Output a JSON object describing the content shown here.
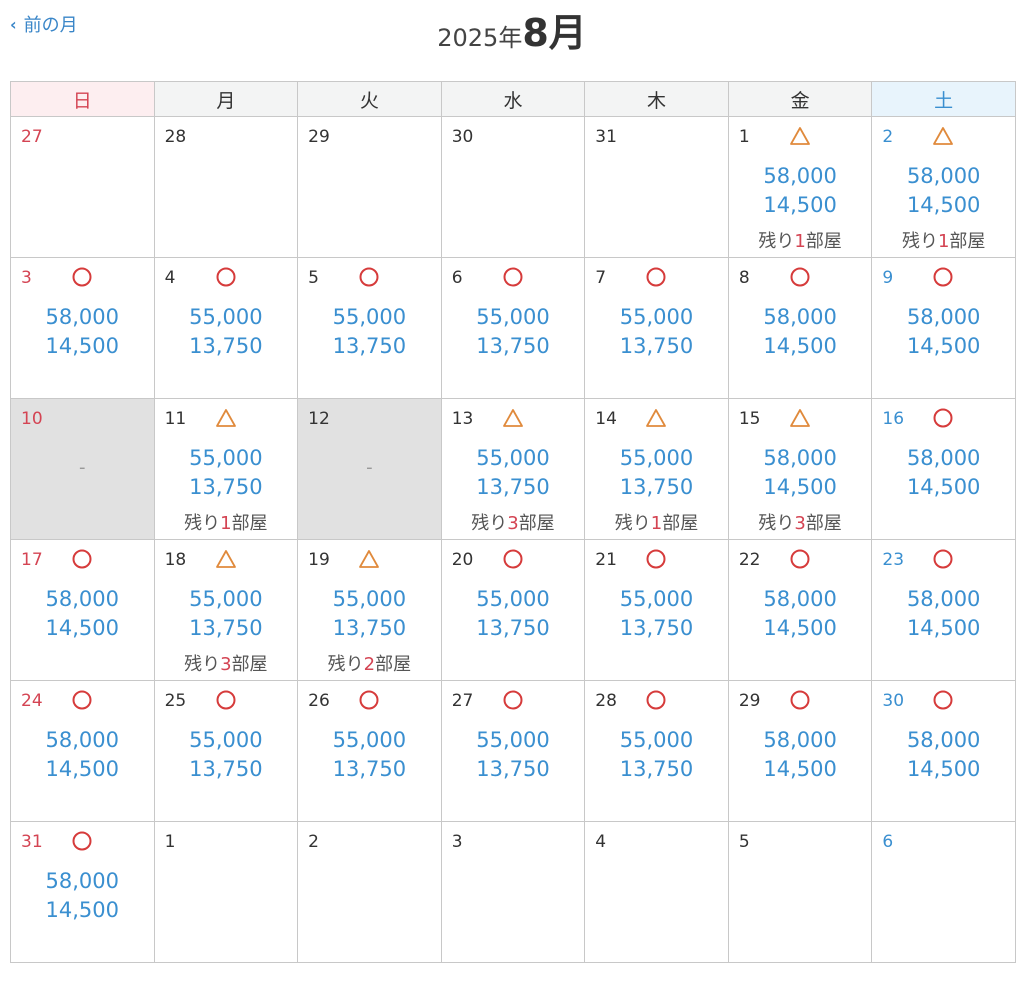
{
  "header": {
    "prev_label": "前の月",
    "year_label": "2025年",
    "month_label": "8月"
  },
  "weekdays": [
    "日",
    "月",
    "火",
    "水",
    "木",
    "金",
    "土"
  ],
  "legend_marks": {
    "circle": "○",
    "triangle": "△"
  },
  "colors": {
    "accent_blue": "#3a8fd0",
    "sunday_red": "#d44453",
    "circle_red": "#d63b3b",
    "triangle_orange": "#e08a3c",
    "closed_gray": "#e1e1e1"
  },
  "remaining_text": {
    "prefix": "残り",
    "suffix": "部屋"
  },
  "weeks": [
    [
      {
        "day": "27"
      },
      {
        "day": "28"
      },
      {
        "day": "29"
      },
      {
        "day": "30"
      },
      {
        "day": "31"
      },
      {
        "day": "1",
        "mark": "triangle",
        "price1": "58,000",
        "price2": "14,500",
        "remaining": "1"
      },
      {
        "day": "2",
        "mark": "triangle",
        "price1": "58,000",
        "price2": "14,500",
        "remaining": "1"
      }
    ],
    [
      {
        "day": "3",
        "mark": "circle",
        "price1": "58,000",
        "price2": "14,500"
      },
      {
        "day": "4",
        "mark": "circle",
        "price1": "55,000",
        "price2": "13,750"
      },
      {
        "day": "5",
        "mark": "circle",
        "price1": "55,000",
        "price2": "13,750"
      },
      {
        "day": "6",
        "mark": "circle",
        "price1": "55,000",
        "price2": "13,750"
      },
      {
        "day": "7",
        "mark": "circle",
        "price1": "55,000",
        "price2": "13,750"
      },
      {
        "day": "8",
        "mark": "circle",
        "price1": "58,000",
        "price2": "14,500"
      },
      {
        "day": "9",
        "mark": "circle",
        "price1": "58,000",
        "price2": "14,500"
      }
    ],
    [
      {
        "day": "10",
        "closed": true,
        "dash": "-"
      },
      {
        "day": "11",
        "mark": "triangle",
        "price1": "55,000",
        "price2": "13,750",
        "remaining": "1"
      },
      {
        "day": "12",
        "closed": true,
        "dash": "-"
      },
      {
        "day": "13",
        "mark": "triangle",
        "price1": "55,000",
        "price2": "13,750",
        "remaining": "3"
      },
      {
        "day": "14",
        "mark": "triangle",
        "price1": "55,000",
        "price2": "13,750",
        "remaining": "1"
      },
      {
        "day": "15",
        "mark": "triangle",
        "price1": "58,000",
        "price2": "14,500",
        "remaining": "3"
      },
      {
        "day": "16",
        "mark": "circle",
        "price1": "58,000",
        "price2": "14,500"
      }
    ],
    [
      {
        "day": "17",
        "mark": "circle",
        "price1": "58,000",
        "price2": "14,500"
      },
      {
        "day": "18",
        "mark": "triangle",
        "price1": "55,000",
        "price2": "13,750",
        "remaining": "3"
      },
      {
        "day": "19",
        "mark": "triangle",
        "price1": "55,000",
        "price2": "13,750",
        "remaining": "2"
      },
      {
        "day": "20",
        "mark": "circle",
        "price1": "55,000",
        "price2": "13,750"
      },
      {
        "day": "21",
        "mark": "circle",
        "price1": "55,000",
        "price2": "13,750"
      },
      {
        "day": "22",
        "mark": "circle",
        "price1": "58,000",
        "price2": "14,500"
      },
      {
        "day": "23",
        "mark": "circle",
        "price1": "58,000",
        "price2": "14,500"
      }
    ],
    [
      {
        "day": "24",
        "mark": "circle",
        "price1": "58,000",
        "price2": "14,500"
      },
      {
        "day": "25",
        "mark": "circle",
        "price1": "55,000",
        "price2": "13,750"
      },
      {
        "day": "26",
        "mark": "circle",
        "price1": "55,000",
        "price2": "13,750"
      },
      {
        "day": "27",
        "mark": "circle",
        "price1": "55,000",
        "price2": "13,750"
      },
      {
        "day": "28",
        "mark": "circle",
        "price1": "55,000",
        "price2": "13,750"
      },
      {
        "day": "29",
        "mark": "circle",
        "price1": "58,000",
        "price2": "14,500"
      },
      {
        "day": "30",
        "mark": "circle",
        "price1": "58,000",
        "price2": "14,500"
      }
    ],
    [
      {
        "day": "31",
        "mark": "circle",
        "price1": "58,000",
        "price2": "14,500"
      },
      {
        "day": "1"
      },
      {
        "day": "2"
      },
      {
        "day": "3"
      },
      {
        "day": "4"
      },
      {
        "day": "5"
      },
      {
        "day": "6"
      }
    ]
  ]
}
